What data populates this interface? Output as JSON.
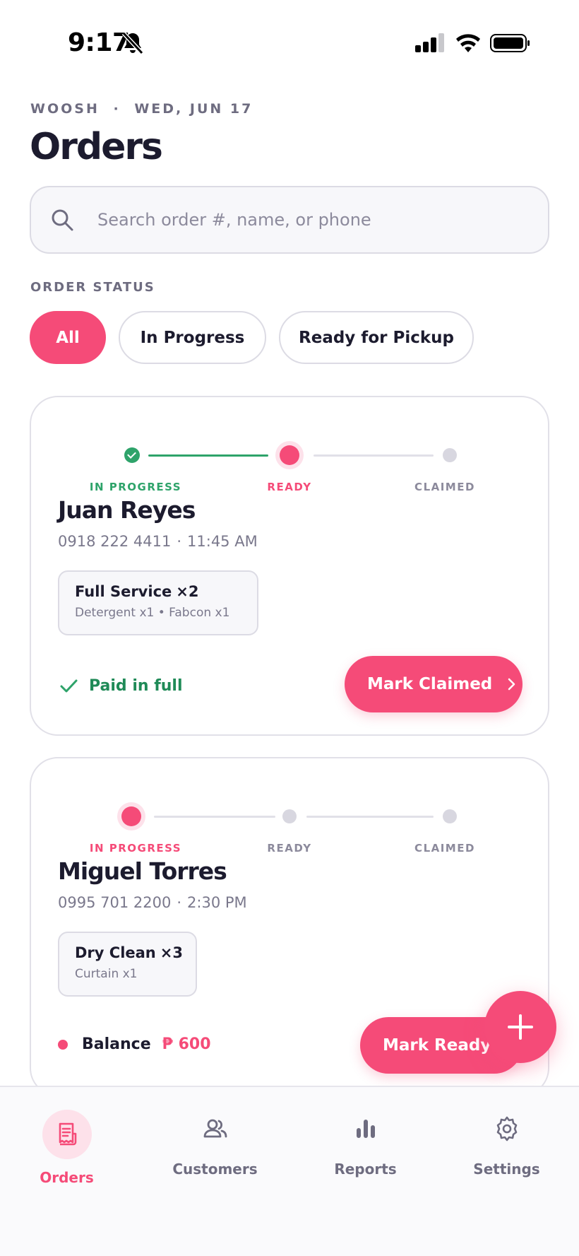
{
  "status_bar": {
    "time": "9:17"
  },
  "header": {
    "brand": "WOOSH",
    "separator": "·",
    "date": "WED, JUN 17",
    "title": "Orders"
  },
  "search": {
    "placeholder": "Search order #, name, or phone",
    "value": ""
  },
  "filters": {
    "label": "ORDER STATUS",
    "chips": [
      "All",
      "In Progress",
      "Ready for Pickup"
    ],
    "selected": "All"
  },
  "steps": [
    "IN PROGRESS",
    "READY",
    "CLAIMED"
  ],
  "orders": [
    {
      "current_step": "READY",
      "customer": "Juan Reyes",
      "phone": "0918 222 4411",
      "time": "11:45 AM",
      "service": "Full Service",
      "quantity": "×2",
      "addons": "Detergent x1 • Fabcon x1",
      "payment": "Paid in full",
      "action": "Mark Claimed"
    },
    {
      "current_step": "IN PROGRESS",
      "customer": "Miguel Torres",
      "phone": "0995 701 2200",
      "time": "2:30 PM",
      "service": "Dry Clean",
      "quantity": "×3",
      "addons": "Curtain x1",
      "balance_label": "Balance",
      "balance_amount": "₱ 600",
      "action": "Mark Ready"
    }
  ],
  "tabs": [
    {
      "label": "Orders",
      "icon": "receipt-icon",
      "active": true
    },
    {
      "label": "Customers",
      "icon": "users-icon",
      "active": false
    },
    {
      "label": "Reports",
      "icon": "bar-chart-icon",
      "active": false
    },
    {
      "label": "Settings",
      "icon": "gear-icon",
      "active": false
    }
  ],
  "colors": {
    "accent": "#f54b78",
    "success": "#2ea36a",
    "text": "#1c1b2e",
    "muted": "#7a788c"
  }
}
